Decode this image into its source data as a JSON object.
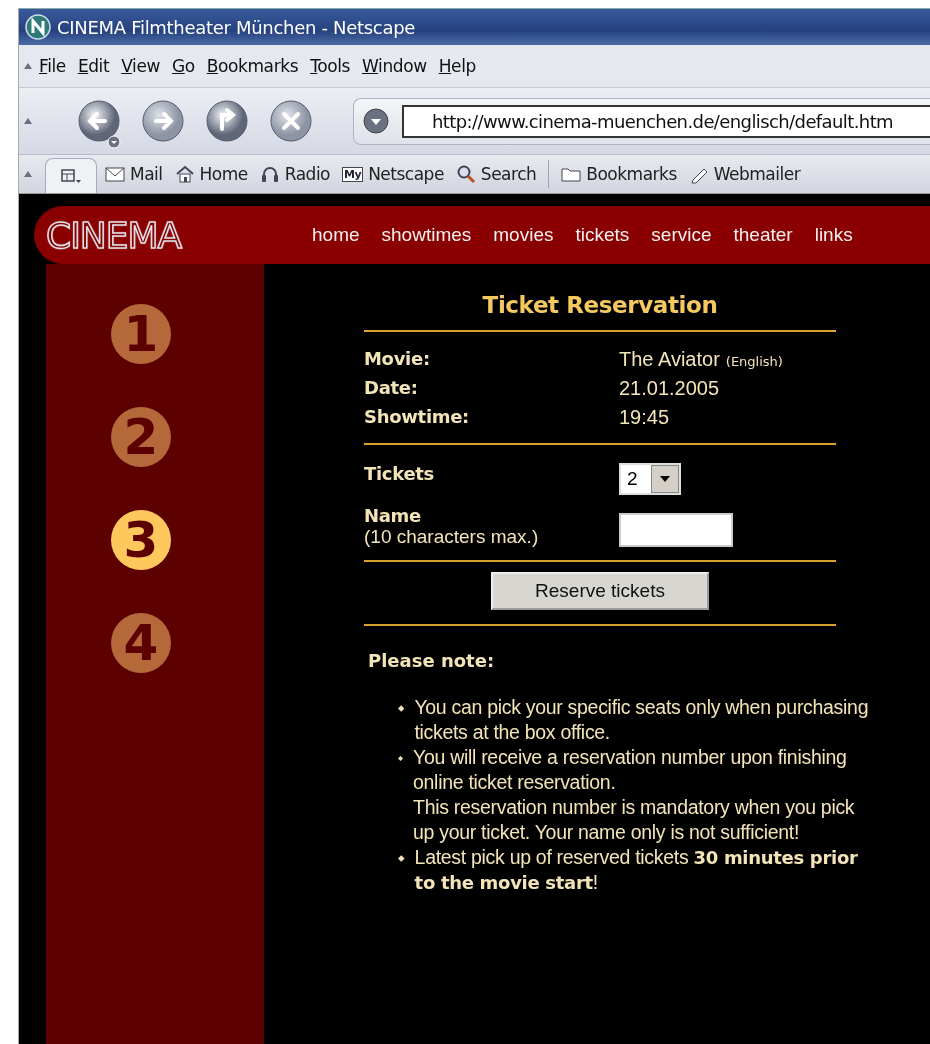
{
  "window": {
    "title": "CINEMA Filmtheater München - Netscape"
  },
  "menu": [
    "File",
    "Edit",
    "View",
    "Go",
    "Bookmarks",
    "Tools",
    "Window",
    "Help"
  ],
  "navigation": {
    "address": "http://www.cinema-muenchen.de/englisch/default.htm"
  },
  "personal_toolbar": [
    {
      "kind": "mail",
      "label": "Mail"
    },
    {
      "kind": "home",
      "label": "Home"
    },
    {
      "kind": "radio",
      "label": "Radio"
    },
    {
      "kind": "my",
      "badge": "My",
      "label": "Netscape"
    },
    {
      "kind": "search",
      "label": "Search"
    },
    {
      "kind": "folder",
      "label": "Bookmarks"
    },
    {
      "kind": "webmailer",
      "label": "Webmailer"
    }
  ],
  "site": {
    "logo": "CINEMA",
    "nav": [
      "home",
      "showtimes",
      "movies",
      "tickets",
      "service",
      "theater",
      "links"
    ]
  },
  "steps": [
    {
      "label": "1",
      "selected": false
    },
    {
      "label": "2",
      "selected": false
    },
    {
      "label": "3",
      "selected": true
    },
    {
      "label": "4",
      "selected": false
    }
  ],
  "reservation": {
    "title": "Ticket Reservation",
    "details": [
      {
        "label": "Movie:",
        "value": "The Aviator",
        "note": "(English)"
      },
      {
        "label": "Date:",
        "value": "21.01.2005"
      },
      {
        "label": "Showtime:",
        "value": "19:45"
      }
    ],
    "tickets": {
      "label": "Tickets",
      "value": "2"
    },
    "name": {
      "label": "Name",
      "hint": "(10 characters max.)"
    },
    "button": "Reserve tickets"
  },
  "notes": {
    "heading": "Please note:",
    "items": [
      {
        "paragraphs": [
          "You can pick your specific seats only when purchasing tickets at the box office."
        ]
      },
      {
        "paragraphs": [
          "You will receive a reservation number upon finishing online ticket reservation.",
          "This reservation number is mandatory when you pick up your ticket. Your name only is not sufficient!"
        ]
      },
      {
        "paragraphs": [
          "Latest pick up of reserved tickets **30 minutes prior to the movie start**!"
        ]
      }
    ]
  }
}
